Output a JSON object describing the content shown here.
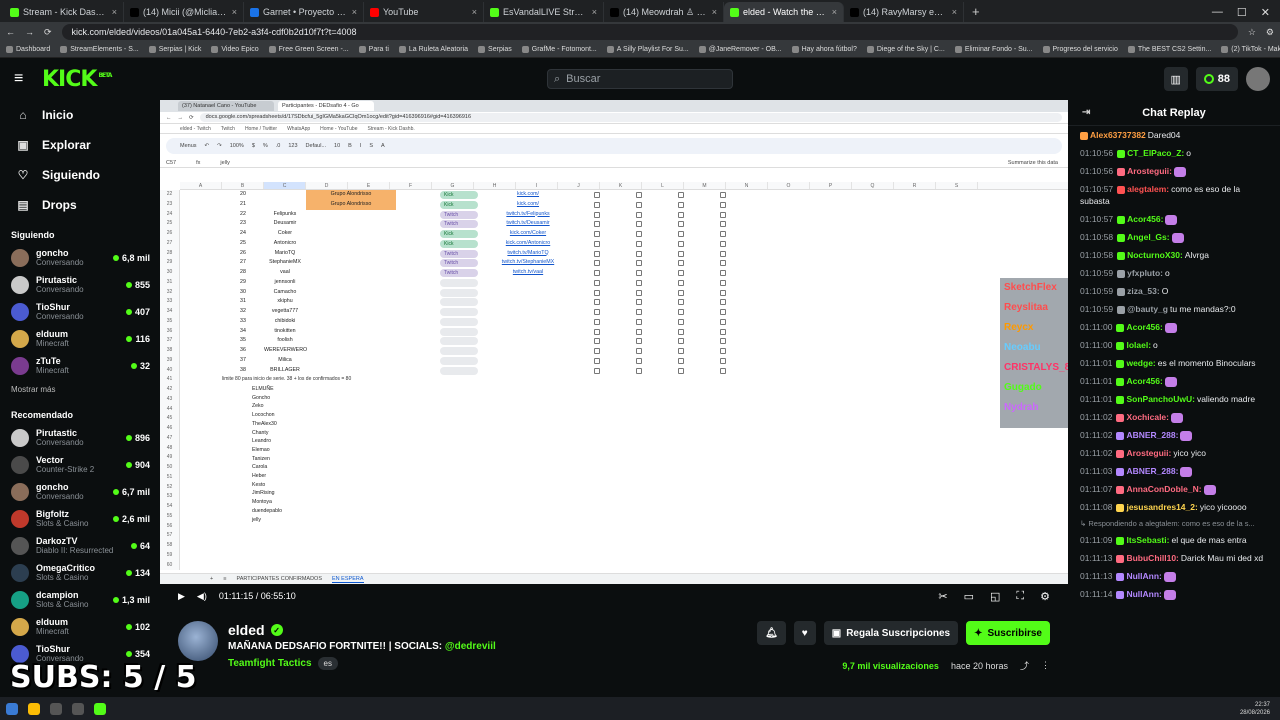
{
  "browser": {
    "tabs": [
      {
        "label": "Stream - Kick Dashboard",
        "color": "#53fc18"
      },
      {
        "label": "(14) Micii (@Miclia00) / X",
        "color": "#000000"
      },
      {
        "label": "Garnet • Proyecto K-pdf - Goo",
        "color": "#1a73e8"
      },
      {
        "label": "YouTube",
        "color": "#ff0000"
      },
      {
        "label": "EsVandalLIVE Stream - Watch Li",
        "color": "#53fc18"
      },
      {
        "label": "(14) Meowdrah ♙ (@_@) en",
        "color": "#000000"
      },
      {
        "label": "elded - Watch the VOD on Kick",
        "color": "#53fc18",
        "active": true
      },
      {
        "label": "(14) RavyMarsy en X: \"Bienvenid",
        "color": "#000000"
      }
    ],
    "url": "kick.com/elded/videos/01a045a1-6440-7eb2-a3f4-cdf0b2d10f7t?t=4008",
    "bookmarks": [
      "Dashboard",
      "StreamElements - S...",
      "Serpias | Kick",
      "Video Epico",
      "Free Green Screen -...",
      "Para ti",
      "La Ruleta Aleatoria",
      "Serpias",
      "GrafMe - Fotomont...",
      "A Silly Playlist For Su...",
      "@JaneRemover - OB...",
      "Hay ahora fútbol?",
      "Diege of the Sky | C...",
      "Eliminar Fondo - Su...",
      "Progreso del servicio",
      "The BEST CS2 Settin...",
      "(2) TikTok - Make Yo..."
    ]
  },
  "header": {
    "logo": "KICK",
    "logo_sup": "BETA",
    "search_placeholder": "Buscar",
    "points": "88"
  },
  "sidebar": {
    "nav": [
      {
        "label": "Inicio",
        "icon": "home-icon",
        "glyph": "⌂"
      },
      {
        "label": "Explorar",
        "icon": "browse-icon",
        "glyph": "▣"
      },
      {
        "label": "Siguiendo",
        "icon": "heart-icon",
        "glyph": "♡"
      },
      {
        "label": "Drops",
        "icon": "drops-icon",
        "glyph": "▤"
      }
    ],
    "following_title": "Siguiendo",
    "following": [
      {
        "name": "goncho",
        "game": "Conversando",
        "viewers": "6,8 mil",
        "color": "#8a6d5a"
      },
      {
        "name": "Pirutastic",
        "game": "Conversando",
        "viewers": "855",
        "color": "#c9c9c9"
      },
      {
        "name": "TioShur",
        "game": "Conversando",
        "viewers": "407",
        "color": "#4b5bd1"
      },
      {
        "name": "elduum",
        "game": "Minecraft",
        "viewers": "116",
        "color": "#d4a84a"
      },
      {
        "name": "zTuTe",
        "game": "Minecraft",
        "viewers": "32",
        "color": "#7a3b8f"
      }
    ],
    "show_more": "Mostrar más",
    "recommended_title": "Recomendado",
    "recommended": [
      {
        "name": "Pirutastic",
        "game": "Conversando",
        "viewers": "896",
        "color": "#c9c9c9"
      },
      {
        "name": "Vector",
        "game": "Counter-Strike 2",
        "viewers": "904",
        "color": "#4a4a4a"
      },
      {
        "name": "goncho",
        "game": "Conversando",
        "viewers": "6,7 mil",
        "color": "#8a6d5a"
      },
      {
        "name": "Bigfoltz",
        "game": "Slots & Casino",
        "viewers": "2,6 mil",
        "color": "#c0392b"
      },
      {
        "name": "DarkozTV",
        "game": "Diablo II: Resurrected",
        "viewers": "64",
        "color": "#555555"
      },
      {
        "name": "OmegaCritico",
        "game": "Slots & Casino",
        "viewers": "134",
        "color": "#2c3e50"
      },
      {
        "name": "dcampion",
        "game": "Slots & Casino",
        "viewers": "1,3 mil",
        "color": "#16a085"
      },
      {
        "name": "elduum",
        "game": "Minecraft",
        "viewers": "102",
        "color": "#d4a84a"
      },
      {
        "name": "TioShur",
        "game": "Conversando",
        "viewers": "354",
        "color": "#4b5bd1"
      }
    ]
  },
  "sheet": {
    "inner_tabs": [
      "(37) Natanael Cano - YouTube",
      "Participantes - DEDsafio 4 - Go"
    ],
    "inner_url": "docs.google.com/spreadsheets/d/17SDbcfui_5gIGMa5kaGCIqOm1ocg/edit?gid=416396916#gid=416396916",
    "cell_ref": "C57",
    "formula": "jelly",
    "summarize": "Summarize this data",
    "columns": [
      "A",
      "B",
      "C",
      "D",
      "E",
      "F",
      "G",
      "H",
      "I",
      "J",
      "K",
      "L",
      "M",
      "N",
      "O",
      "P",
      "Q",
      "R",
      "S"
    ],
    "row_start": 22,
    "rows": [
      {
        "n": "20",
        "name": "",
        "group": "Grupo Alondrisso",
        "plat": "Kick",
        "link": "kick.com/"
      },
      {
        "n": "21",
        "name": "",
        "group": "Grupo Alondrisso",
        "plat": "Kick",
        "link": "kick.com/"
      },
      {
        "n": "22",
        "name": "Felipunks",
        "group": "",
        "plat": "Twitch",
        "link": "twitch.tv/Felipunks"
      },
      {
        "n": "23",
        "name": "Deusamir",
        "group": "",
        "plat": "Twitch",
        "link": "twitch.tv/Deusamir"
      },
      {
        "n": "24",
        "name": "Coker",
        "group": "",
        "plat": "Kick",
        "link": "kick.com/Coker"
      },
      {
        "n": "25",
        "name": "Antonicro",
        "group": "",
        "plat": "Kick",
        "link": "kick.com/Antonicro"
      },
      {
        "n": "26",
        "name": "MarioTQ",
        "group": "",
        "plat": "Twitch",
        "link": "twitch.tv/MarioTQ"
      },
      {
        "n": "27",
        "name": "StephanieMX",
        "group": "",
        "plat": "Twitch",
        "link": "twitch.tv/StephanieMX"
      },
      {
        "n": "28",
        "name": "vaal",
        "group": "",
        "plat": "Twitch",
        "link": "twitch.tv/vaal"
      },
      {
        "n": "29",
        "name": "jennsonli",
        "group": "",
        "plat": "",
        "link": ""
      },
      {
        "n": "30",
        "name": "Camacho",
        "group": "",
        "plat": "",
        "link": ""
      },
      {
        "n": "31",
        "name": "xkiphu",
        "group": "",
        "plat": "",
        "link": ""
      },
      {
        "n": "32",
        "name": "vegetta777",
        "group": "",
        "plat": "",
        "link": ""
      },
      {
        "n": "33",
        "name": "chibidoki",
        "group": "",
        "plat": "",
        "link": ""
      },
      {
        "n": "34",
        "name": "tinokitten",
        "group": "",
        "plat": "",
        "link": ""
      },
      {
        "n": "35",
        "name": "foolish",
        "group": "",
        "plat": "",
        "link": ""
      },
      {
        "n": "36",
        "name": "WEREVERWERO",
        "group": "",
        "plat": "",
        "link": ""
      },
      {
        "n": "37",
        "name": "Milica",
        "group": "",
        "plat": "",
        "link": ""
      },
      {
        "n": "38",
        "name": "BRILLAGER",
        "group": "",
        "plat": "",
        "link": ""
      }
    ],
    "note": "limite 80 para inicio de serie. 38 + los de confirmados = 80",
    "waitlist": [
      "ELMUÑE",
      "Goncho",
      "Zeko",
      "Locochon",
      "TheAlex30",
      "Chanty",
      "Leandro",
      "Elemao",
      "Tanizen",
      "Carola",
      "Heber",
      "Kesto",
      "JimRising",
      "Montoya",
      "duendepablo",
      "jelly"
    ],
    "sheet_tabs": [
      "PARTICIPANTES CONFIRMADOS",
      "EN ESPERA"
    ]
  },
  "overlay_chat": [
    {
      "user": "SketchFlex",
      "color": "#ff4d4d"
    },
    {
      "user": "Reyslitaa",
      "color": "#ff4d4d"
    },
    {
      "user": "Reycx",
      "color": "#ff9900"
    },
    {
      "user": "Neoabu",
      "color": "#66ccff"
    },
    {
      "user": "CRISTALYS_8525",
      "color": "#ff3366"
    },
    {
      "user": "Gugado",
      "color": "#53fc18"
    },
    {
      "user": "Nydrah",
      "color": "#cc66ff"
    }
  ],
  "player": {
    "current": "01:11:15",
    "duration": "06:55:10",
    "progress": 0.171
  },
  "stream": {
    "name": "elded",
    "title": "MAÑANA DEDSAFIO FORTNITE!! | SOCIALS: ",
    "handle": "@dedreviil",
    "category": "Teamfight Tactics",
    "lang": "es",
    "subscribe_gift": "Regala Suscripciones",
    "subscribe": "Suscribirse",
    "views": "9,7 mil visualizaciones",
    "ago": "hace 20 horas"
  },
  "overlay_subs": "SUBS: 5 / 5",
  "chat": {
    "title": "Chat Replay",
    "messages": [
      {
        "ts": "",
        "user": "Alex63737382",
        "color": "#ff9f43",
        "text": "Dared04",
        "emote": false
      },
      {
        "ts": "01:10:56",
        "user": "CT_ElPaco_Z:",
        "color": "#53fc18",
        "text": "o",
        "emote": false
      },
      {
        "ts": "01:10:56",
        "user": "Arosteguii:",
        "color": "#ff6b81",
        "text": "",
        "emote": true
      },
      {
        "ts": "01:10:57",
        "user": "alegtalem:",
        "color": "#ff5252",
        "text": "como es eso de la subasta",
        "emote": false
      },
      {
        "ts": "01:10:57",
        "user": "Acor456:",
        "color": "#53fc18",
        "text": "",
        "emote": true
      },
      {
        "ts": "01:10:58",
        "user": "Angel_Gs:",
        "color": "#53fc18",
        "text": "",
        "emote": true
      },
      {
        "ts": "01:10:58",
        "user": "NocturnoX30:",
        "color": "#53fc18",
        "text": "Alvrga",
        "emote": false
      },
      {
        "ts": "01:10:59",
        "user": "yfxpluto:",
        "color": "#9aa0a6",
        "text": "o",
        "emote": false
      },
      {
        "ts": "01:10:59",
        "user": "ziza_53:",
        "color": "#9aa0a6",
        "text": "O",
        "emote": false
      },
      {
        "ts": "01:10:59",
        "user": "@bauty_g",
        "color": "#9aa0a6",
        "text": "tu me mandas?:0",
        "emote": false
      },
      {
        "ts": "01:11:00",
        "user": "Acor456:",
        "color": "#53fc18",
        "text": "",
        "emote": true
      },
      {
        "ts": "01:11:00",
        "user": "lolael:",
        "color": "#53fc18",
        "text": "o",
        "emote": false
      },
      {
        "ts": "01:11:01",
        "user": "wedge:",
        "color": "#53fc18",
        "text": "es el momento Binoculars",
        "emote": false
      },
      {
        "ts": "01:11:01",
        "user": "Acor456:",
        "color": "#53fc18",
        "text": "",
        "emote": true
      },
      {
        "ts": "01:11:01",
        "user": "SonPanchoUwU:",
        "color": "#53fc18",
        "text": "valiendo madre",
        "emote": false
      },
      {
        "ts": "01:11:02",
        "user": "Xochicale:",
        "color": "#ff6b81",
        "text": "",
        "emote": true
      },
      {
        "ts": "01:11:02",
        "user": "ABNER_288:",
        "color": "#b388ff",
        "text": "",
        "emote": true
      },
      {
        "ts": "01:11:02",
        "user": "Arosteguii:",
        "color": "#ff6b81",
        "text": "yico yico",
        "emote": false
      },
      {
        "ts": "01:11:03",
        "user": "ABNER_288:",
        "color": "#b388ff",
        "text": "",
        "emote": true
      },
      {
        "ts": "01:11:07",
        "user": "AnnaConDoble_N:",
        "color": "#ff6b81",
        "text": "",
        "emote": true
      },
      {
        "ts": "01:11:08",
        "user": "jesusandres14_2:",
        "color": "#ffd54f",
        "text": "yico yicoooo",
        "emote": false
      }
    ],
    "reply_note": "↳ Respondiendo a alegtalem: como es eso de la s...",
    "messages2": [
      {
        "ts": "01:11:09",
        "user": "ItsSebasti:",
        "color": "#53fc18",
        "text": "el que de mas entra"
      },
      {
        "ts": "01:11:13",
        "user": "BubuChill10:",
        "color": "#ff6b81",
        "text": "Darick Mau mi ded xd"
      },
      {
        "ts": "01:11:13",
        "user": "NullAnn:",
        "color": "#b388ff",
        "text": ""
      },
      {
        "ts": "01:11:14",
        "user": "NullAnn:",
        "color": "#b388ff",
        "text": ""
      }
    ]
  },
  "taskbar": {
    "time": "22:37",
    "date": "28/08/2026"
  }
}
